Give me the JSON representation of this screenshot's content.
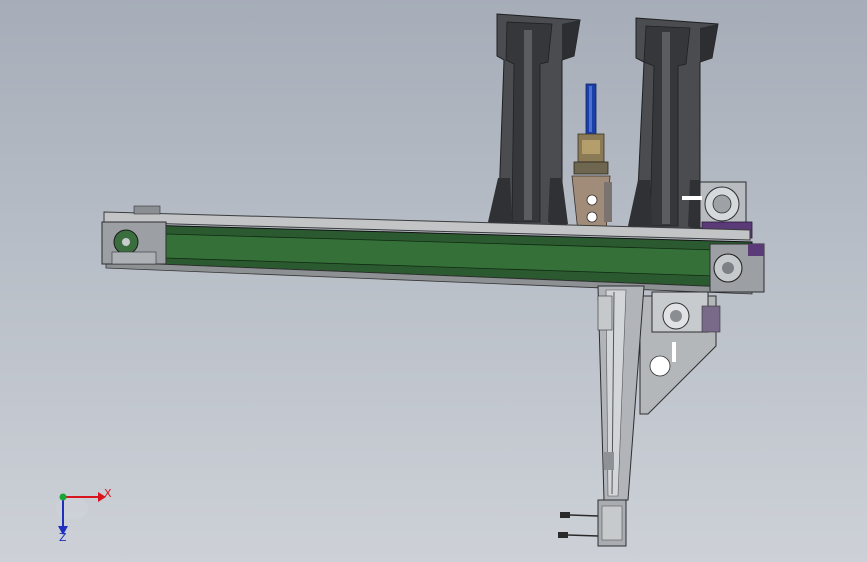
{
  "viewport": {
    "background_top": "#a6adb8",
    "background_bottom": "#cdd1d7"
  },
  "model": {
    "frame_color": "#c2c4c6",
    "belt_color": "#2c5a30",
    "column_color": "#3d3f42",
    "rod_color": "#1a3fa8",
    "accent_purple": "#5b3a78"
  },
  "triad": {
    "x_label": "X",
    "z_label": "Z",
    "x_color": "#d8141e",
    "y_color": "#1aa53a",
    "z_color": "#1e2fc0"
  }
}
